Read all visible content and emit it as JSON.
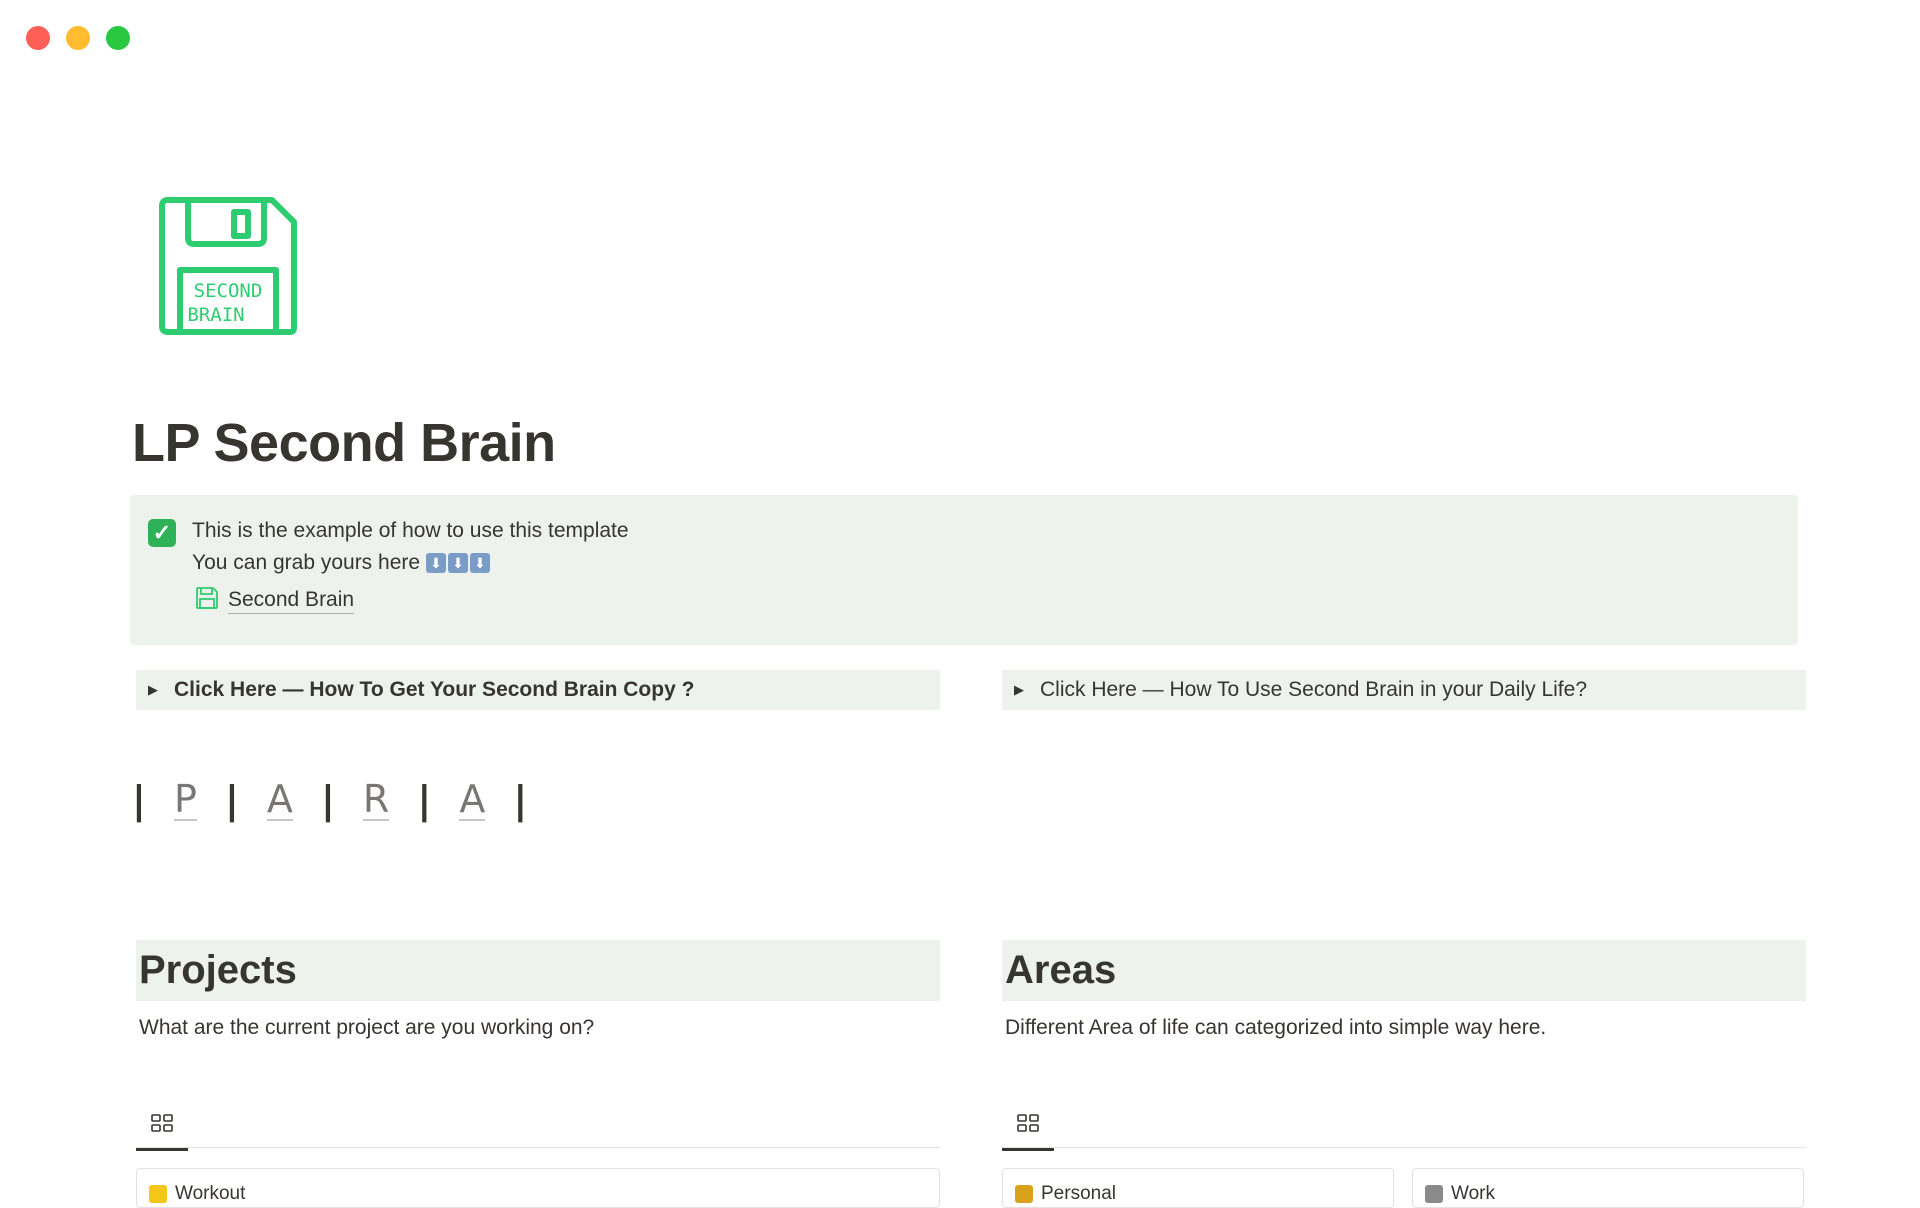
{
  "window": {
    "controls": [
      "close",
      "minimize",
      "zoom"
    ]
  },
  "page": {
    "icon": "floppy-disk-icon",
    "icon_text_line1": "SECOND",
    "icon_text_line2": "BRAIN",
    "title": "LP Second Brain"
  },
  "callout": {
    "icon": "check-mark-button-icon",
    "line1": "This is the example of how to use this template",
    "line2": "You can grab yours here",
    "arrows_icon": "down-arrow-emoji-icons",
    "link_icon": "floppy-disk-icon",
    "link_label": "Second Brain"
  },
  "toggles": {
    "left": "Click Here — How To Get Your Second Brain Copy ?",
    "right": "Click Here — How To Use Second Brain in your Daily Life?"
  },
  "para": {
    "separator": "|",
    "letters": [
      "P",
      "A",
      "R",
      "A"
    ]
  },
  "projects": {
    "heading": "Projects",
    "description": "What are the current project are you working on?",
    "view_icon": "gallery-view-icon",
    "cards": [
      "Workout"
    ]
  },
  "areas": {
    "heading": "Areas",
    "description": "Different Area of life can categorized into simple way here.",
    "view_icon": "gallery-view-icon",
    "cards": [
      "Personal",
      "Work"
    ]
  },
  "colors": {
    "accent_green": "#2ecc71",
    "callout_bg": "#edf3ec",
    "text": "#37352f"
  }
}
